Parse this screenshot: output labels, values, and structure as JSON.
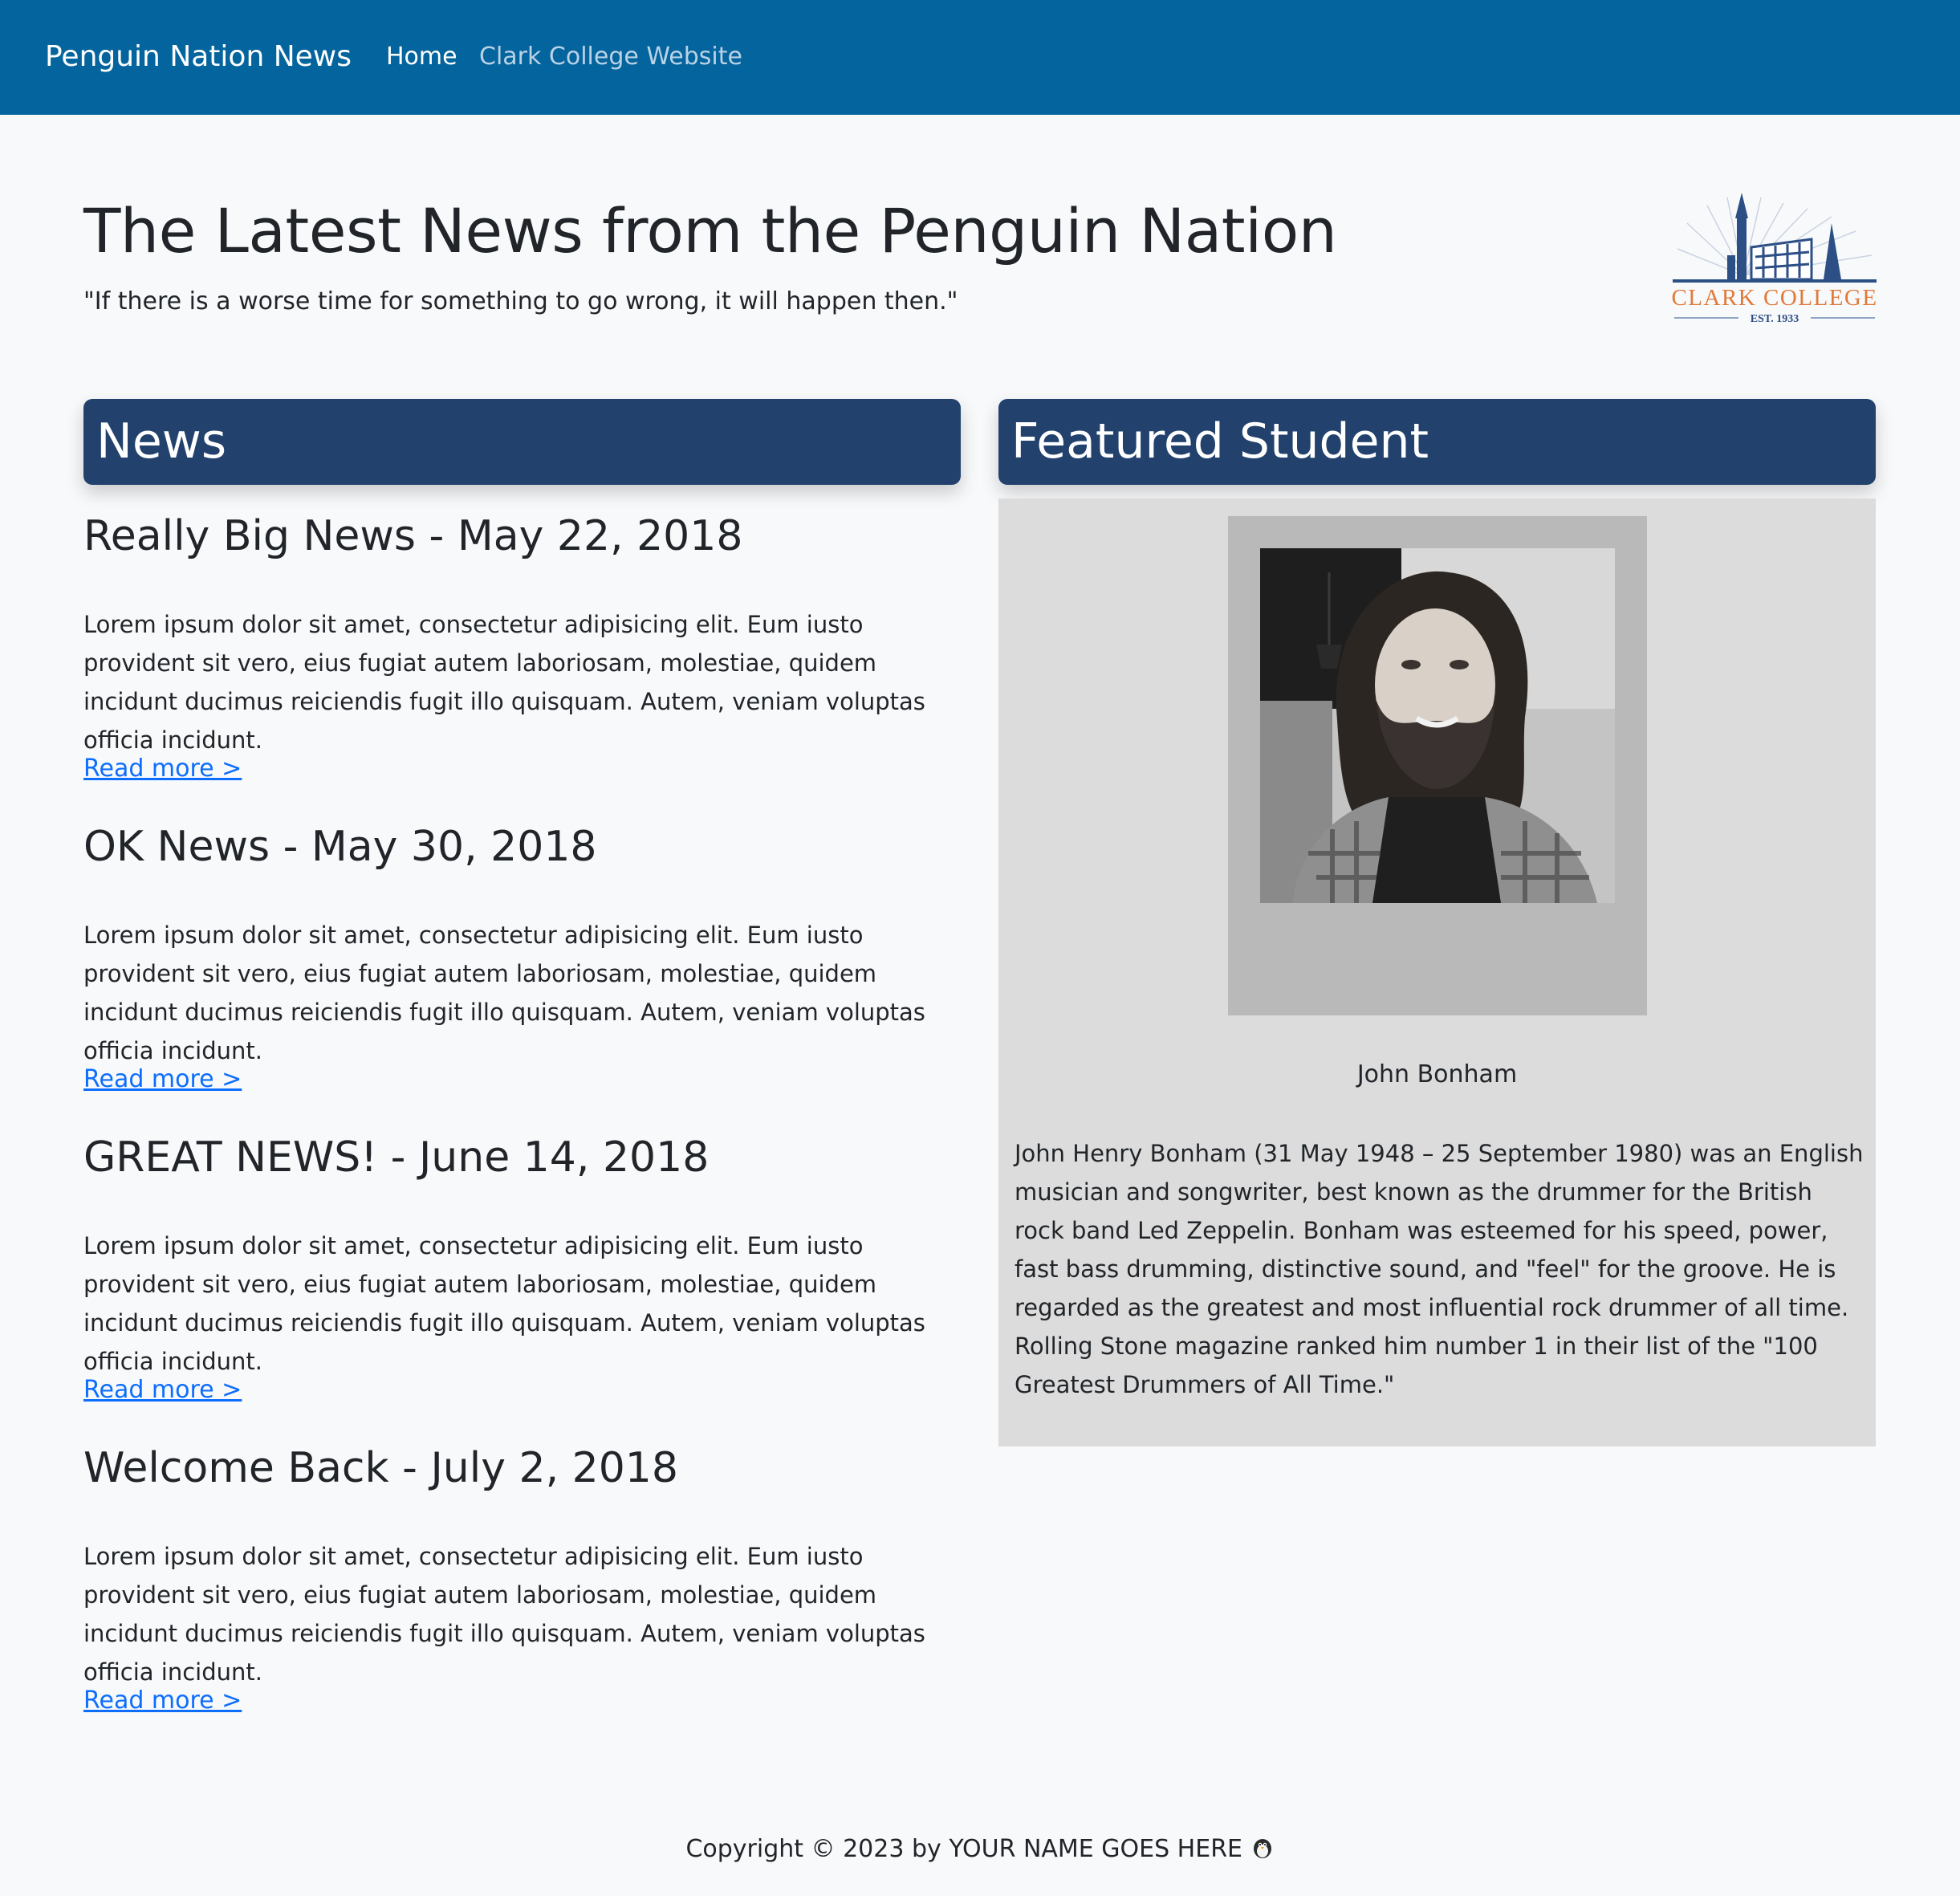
{
  "navbar": {
    "brand": "Penguin Nation News",
    "links": [
      {
        "label": "Home"
      },
      {
        "label": "Clark College Website"
      }
    ],
    "colors": {
      "background": "#04649d",
      "active": "#ffffff",
      "inactive": "#b9d2e6"
    }
  },
  "header": {
    "title": "The Latest News from the Penguin Nation",
    "tagline": "\"If there is a worse time for something to go wrong, it will happen then.\"",
    "logo": {
      "name": "CLARK COLLEGE",
      "established": "EST. 1933"
    }
  },
  "news": {
    "heading": "News",
    "articles": [
      {
        "title": "Really Big News - May 22, 2018",
        "body": "Lorem ipsum dolor sit amet, consectetur adipisicing elit. Eum iusto provident sit vero, eius fugiat autem laboriosam, molestiae, quidem incidunt ducimus reiciendis fugit illo quisquam. Autem, veniam voluptas officia incidunt.",
        "link": "Read more >"
      },
      {
        "title": "OK News - May 30, 2018",
        "body": "Lorem ipsum dolor sit amet, consectetur adipisicing elit. Eum iusto provident sit vero, eius fugiat autem laboriosam, molestiae, quidem incidunt ducimus reiciendis fugit illo quisquam. Autem, veniam voluptas officia incidunt.",
        "link": "Read more >"
      },
      {
        "title": "GREAT NEWS! - June 14, 2018",
        "body": "Lorem ipsum dolor sit amet, consectetur adipisicing elit. Eum iusto provident sit vero, eius fugiat autem laboriosam, molestiae, quidem incidunt ducimus reiciendis fugit illo quisquam. Autem, veniam voluptas officia incidunt.",
        "link": "Read more >"
      },
      {
        "title": "Welcome Back - July 2, 2018",
        "body": "Lorem ipsum dolor sit amet, consectetur adipisicing elit. Eum iusto provident sit vero, eius fugiat autem laboriosam, molestiae, quidem incidunt ducimus reiciendis fugit illo quisquam. Autem, veniam voluptas officia incidunt.",
        "link": "Read more >"
      }
    ]
  },
  "featured": {
    "heading": "Featured Student",
    "name": "John Bonham",
    "bio": "John Henry Bonham (31 May 1948 – 25 September 1980) was an English musician and songwriter, best known as the drummer for the British rock band Led Zeppelin. Bonham was esteemed for his speed, power, fast bass drumming, distinctive sound, and \"feel\" for the groove. He is regarded as the greatest and most influential rock drummer of all time. Rolling Stone magazine ranked him number 1 in their list of the \"100 Greatest Drummers of All Time.\""
  },
  "footer": {
    "text": "Copyright © 2023 by YOUR NAME GOES HERE",
    "icon": "penguin-icon"
  },
  "colors": {
    "section_header": "#22426d",
    "link": "#0d6efd",
    "page_background": "#f8f9fa",
    "featured_background": "#dcdcdc",
    "logo_text": "#e07a3a",
    "logo_blue": "#2c4f86"
  }
}
